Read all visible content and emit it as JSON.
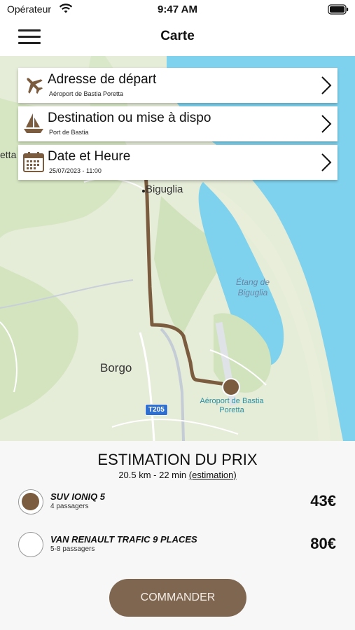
{
  "status_bar": {
    "carrier": "Opérateur",
    "time": "9:47 AM"
  },
  "nav": {
    "title": "Carte",
    "menu_icon": "hamburger-icon"
  },
  "map": {
    "labels": {
      "biguglia": "Biguglia",
      "borgo": "Borgo",
      "etang": "Étang de Biguglia",
      "airport": "Aéroport de Bastia Poretta",
      "poretta_edge": "etta",
      "road": "T205"
    },
    "colors": {
      "water": "#7fd2ee",
      "land": "#e4ecd6",
      "route": "#7b5c3f"
    }
  },
  "cards": [
    {
      "icon": "airplane-icon",
      "title": "Adresse de départ",
      "subtitle": "Aéroport de Bastia Poretta"
    },
    {
      "icon": "sailboat-icon",
      "title": "Destination ou mise à dispo",
      "subtitle": "Port de Bastia"
    },
    {
      "icon": "calendar-icon",
      "title": "Date et Heure",
      "subtitle": "25/07/2023 - 11:00"
    }
  ],
  "estimate": {
    "title": "ESTIMATION DU PRIX",
    "distance_time": "20.5 km - 22 min",
    "link": "(estimation)"
  },
  "options": [
    {
      "name": "SUV IONIQ 5",
      "desc": "4 passagers",
      "price": "43€",
      "selected": true
    },
    {
      "name": "VAN RENAULT TRAFIC 9 PLACES",
      "desc": "5-8 passagers",
      "price": "80€",
      "selected": false
    }
  ],
  "cta": {
    "label": "COMMANDER",
    "color": "#7f6650"
  }
}
